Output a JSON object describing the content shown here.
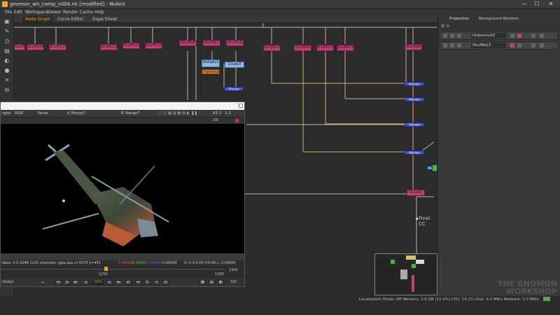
{
  "window": {
    "title": "gnomon_wn_comp_v004.nk [modified] - NukeX",
    "minimize": "—",
    "maximize": "☐",
    "close": "✕"
  },
  "menu": [
    "File",
    "Edit",
    "Workspace",
    "Viewer",
    "Render",
    "Cache",
    "Help"
  ],
  "tabs": [
    {
      "label": "Node Graph"
    },
    {
      "label": "Curve Editor"
    },
    {
      "label": "Dope Sheet"
    }
  ],
  "nodes": {
    "s11": "Shuffle11",
    "s14": "Shuffle14",
    "s13a": "Shuffle13",
    "s12": "Shuffle12",
    "s15": "Shuffle15",
    "s16": "Shuffle16",
    "s8": "Shuffle8",
    "s7": "Shuffle7",
    "s6": "Shuffle6",
    "s19": "Shuffle19",
    "s9": "Shuffle9",
    "s17": "Shuffle17",
    "s18": "Shuffle18",
    "s4": "Shuffle4",
    "multiply": "Multiply1",
    "grade": "Grade3",
    "unp": "Unpremult",
    "m1": "Merge",
    "m2": "Merge",
    "m3": "Merge",
    "m4": "Merge",
    "m5": "Merge",
    "m6": "Merge",
    "grade1": "Grade1",
    "final": "Final CC"
  },
  "viewer": {
    "channel": "rgba",
    "colorspace": "RGB",
    "none": "None",
    "input_a_label": "A",
    "input_a": "Merge7",
    "input_b_label": "B",
    "input_b": "Merge7",
    "zoom": "83.3",
    "ratio": "1:1",
    "view_mode": "2D",
    "status_left": "bbox: 0 0 2048 1125 channels: rgba,das  x=1570 y=451",
    "status_r": "0.00000",
    "status_g": "0.00000",
    "status_b": "0.00000",
    "status_a": "0.00000",
    "status_hsv": "H: 0 S:0.00 V:0.00  L: 0.00000",
    "frame_start": "1250",
    "frame_current": "1251",
    "frame_end": "1300",
    "frame_field": "1251",
    "fps": "101",
    "global": "Global",
    "mid_frame": "1250",
    "end_frame": "1300"
  },
  "properties": {
    "tabs": [
      {
        "label": "Properties"
      },
      {
        "label": "Background Renders"
      }
    ],
    "rows": [
      {
        "name": "Unpremult2"
      },
      {
        "name": "Shuffle13"
      }
    ]
  },
  "status": {
    "text": "Localization Mode: Off  Memory: 3.9 GB (12.4%)  CPU: 14.1%  Disk: 0.0 MB/s  Network: 0.0 MB/s"
  },
  "watermark": {
    "line1": "THE GNOMON",
    "line2": "WORKSHOP"
  },
  "colors": {
    "shuffle": "#c1407a",
    "merge": "#4655c8",
    "accent": "#f0a030",
    "pipe_yellow": "#d9b070"
  },
  "icons": {
    "tool_icons": [
      "viewer-icon",
      "draw-icon",
      "time-icon",
      "channel-icon",
      "color-icon",
      "filter-icon",
      "keyer-icon",
      "merge-icon",
      "transform-icon",
      "3d-icon",
      "particles-icon"
    ]
  }
}
